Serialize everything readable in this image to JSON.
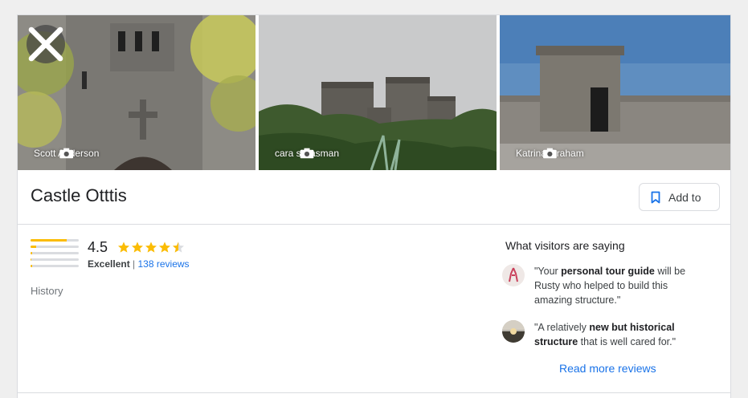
{
  "photos": [
    {
      "credit": "Scott Anderson"
    },
    {
      "credit": "cara silvasman"
    },
    {
      "credit": "Katrina Graham"
    }
  ],
  "place": {
    "title": "Castle Otttis",
    "add_label": "Add to",
    "rating": "4.5",
    "rating_word": "Excellent",
    "separator": " | ",
    "reviews_count": "138 reviews",
    "category": "History",
    "rating_bars": [
      0.75,
      0.12,
      0.03,
      0.02,
      0.03
    ]
  },
  "visitors": {
    "heading": "What visitors are saying",
    "reviews": [
      {
        "pre": "\"Your ",
        "bold": "personal tour guide",
        "post": " will be Rusty who helped to build this amazing structure.\""
      },
      {
        "pre": "\"A relatively ",
        "bold": "new but historical structure",
        "post": " that is well cared for.\""
      }
    ],
    "more_label": "Read more reviews"
  },
  "colors": {
    "star": "#fbbc04",
    "link": "#1a73e8"
  }
}
